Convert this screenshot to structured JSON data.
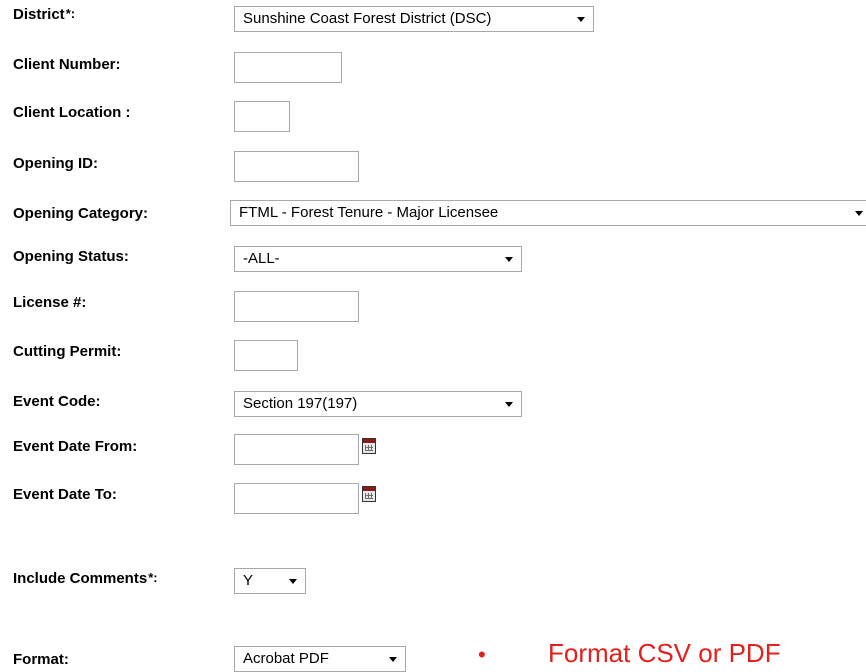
{
  "form": {
    "district": {
      "label": "District",
      "required_mark": "*:",
      "value": "Sunshine Coast Forest District (DSC)"
    },
    "client_number": {
      "label": "Client Number:",
      "value": ""
    },
    "client_location": {
      "label": "Client Location :",
      "value": ""
    },
    "opening_id": {
      "label": "Opening ID:",
      "value": ""
    },
    "opening_category": {
      "label": "Opening Category:",
      "value": "FTML - Forest Tenure - Major Licensee"
    },
    "opening_status": {
      "label": "Opening Status:",
      "value": "-ALL-"
    },
    "license": {
      "label": "License #:",
      "value": ""
    },
    "cutting_permit": {
      "label": "Cutting Permit:",
      "value": ""
    },
    "event_code": {
      "label": "Event Code:",
      "value": "Section 197(197)"
    },
    "event_date_from": {
      "label": "Event Date From:",
      "value": ""
    },
    "event_date_to": {
      "label": "Event Date To:",
      "value": ""
    },
    "include_comments": {
      "label": "Include Comments",
      "required_mark": "*:",
      "value": "Y"
    },
    "format": {
      "label": "Format:",
      "value": "Acrobat PDF"
    }
  },
  "note": {
    "bullet": "•",
    "text": "Format CSV or PDF"
  },
  "icons": {
    "calendar": "calendar-icon",
    "dropdown": "chevron-down-icon"
  },
  "colors": {
    "note": "#e0211e",
    "border": "#a9a9a9"
  }
}
